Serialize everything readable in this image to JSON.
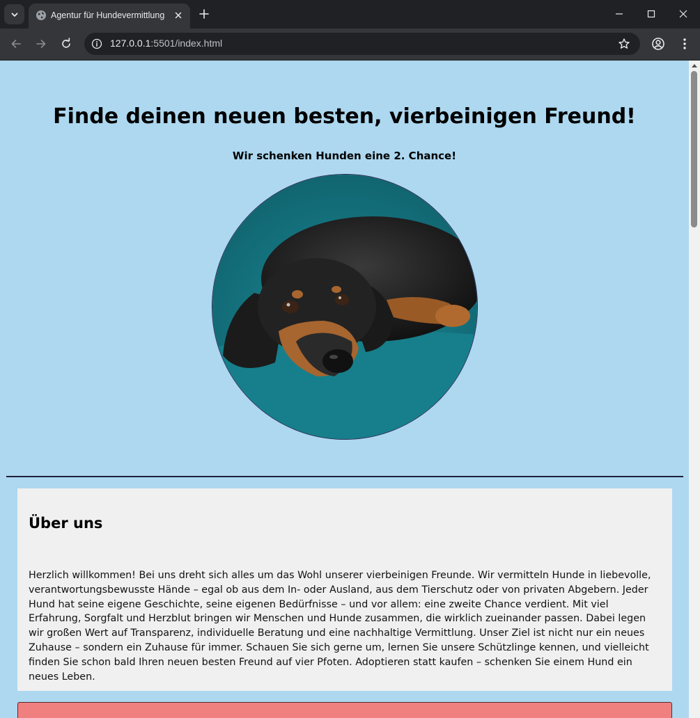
{
  "browser": {
    "tab_title": "Agentur für Hundevermittlung",
    "url_host": "127.0.0.1",
    "url_path": ":5501/index.html"
  },
  "page": {
    "title": "Finde deinen neuen besten, vierbeinigen Freund!",
    "subtitle": "Wir schenken Hunden eine 2. Chance!",
    "hero_image": "dachshund-lying-on-teal-blanket",
    "about": {
      "heading": "Über uns",
      "text": "Herzlich willkommen! Bei uns dreht sich alles um das Wohl unserer vierbeinigen Freunde. Wir vermitteln Hunde in liebevolle, verantwortungsbewusste Hände – egal ob aus dem In- oder Ausland, aus dem Tierschutz oder von privaten Abgebern. Jeder Hund hat seine eigene Geschichte, seine eigenen Bedürfnisse – und vor allem: eine zweite Chance verdient. Mit viel Erfahrung, Sorgfalt und Herzblut bringen wir Menschen und Hunde zusammen, die wirklich zueinander passen. Dabei legen wir großen Wert auf Transparenz, individuelle Beratung und eine nachhaltige Vermittlung. Unser Ziel ist nicht nur ein neues Zuhause – sondern ein Zuhause für immer. Schauen Sie sich gerne um, lernen Sie unsere Schützlinge kennen, und vielleicht finden Sie schon bald Ihren neuen besten Freund auf vier Pfoten. Adoptieren statt kaufen – schenken Sie einem Hund ein neues Leben."
    }
  },
  "colors": {
    "page_bg": "#add8f0",
    "card_bg": "#f0f0f0",
    "accent_box": "#f08080"
  }
}
